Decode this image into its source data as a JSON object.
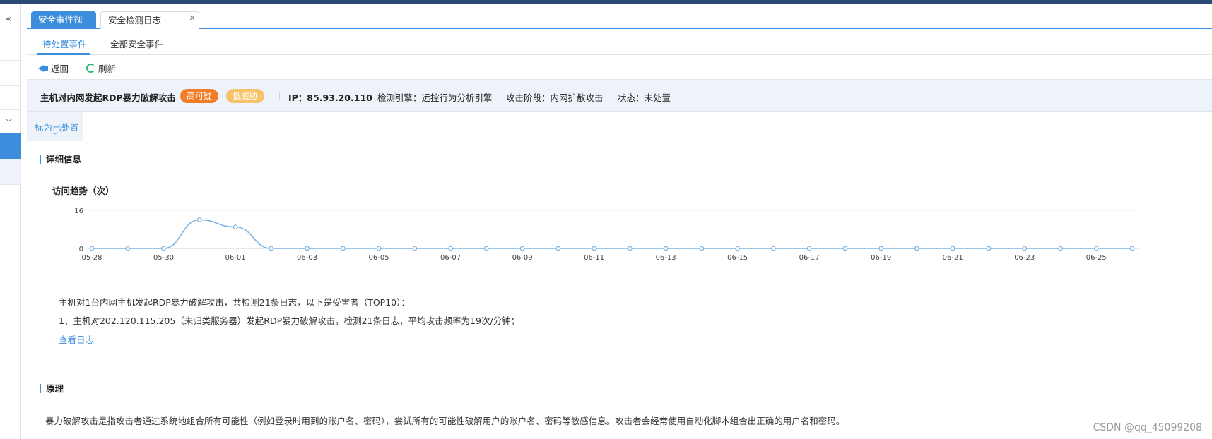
{
  "sidebar": {
    "collapse_glyph": "«"
  },
  "tabs": [
    {
      "label": "安全事件视角",
      "active": true
    },
    {
      "label": "安全检测日志",
      "active": false,
      "close_glyph": "×"
    }
  ],
  "subtabs": [
    {
      "label": "待处置事件",
      "active": true
    },
    {
      "label": "全部安全事件",
      "active": false
    }
  ],
  "toolbar": {
    "back_label": "返回",
    "refresh_label": "刷新"
  },
  "event": {
    "title": "主机对内网发起RDP暴力破解攻击",
    "badge_high": "高可疑",
    "badge_low": "低威胁",
    "ip": "IP：85.93.20.110",
    "engine": "检测引擎：远控行为分析引擎",
    "stage": "攻击阶段：内网扩散攻击",
    "status": "状态：未处置"
  },
  "mark_button_label": "标为已处置",
  "details": {
    "section_title": "详细信息",
    "chart_title": "访问趋势（次）",
    "summary": "主机对1台内网主机发起RDP暴力破解攻击，共检测21条日志，以下是受害者（TOP10）：",
    "item1": "1、主机对202.120.115.205（未归类服务器）发起RDP暴力破解攻击，检测21条日志，平均攻击频率为19次/分钟；",
    "view_log_link": "查看日志"
  },
  "principle": {
    "section_title": "原理",
    "text": "暴力破解攻击是指攻击者通过系统地组合所有可能性（例如登录时用到的账户名、密码），尝试所有的可能性破解用户的账户名、密码等敏感信息。攻击者会经常使用自动化脚本组合出正确的用户名和密码。"
  },
  "watermark": "CSDN @qq_45099208",
  "colors": {
    "accent": "#3c8ddc",
    "line": "#7ab3e3",
    "badge_high": "#f47b27",
    "badge_low": "#f7c469"
  },
  "chart_data": {
    "type": "line",
    "title": "访问趋势（次）",
    "x": [
      "05-28",
      "05-29",
      "05-30",
      "05-31",
      "06-01",
      "06-02",
      "06-03",
      "06-04",
      "06-05",
      "06-06",
      "06-07",
      "06-08",
      "06-09",
      "06-10",
      "06-11",
      "06-12",
      "06-13",
      "06-14",
      "06-15",
      "06-16",
      "06-17",
      "06-18",
      "06-19",
      "06-20",
      "06-21",
      "06-22",
      "06-23",
      "06-24",
      "06-25",
      "06-26"
    ],
    "x_tick_labels": [
      "05-28",
      "05-30",
      "06-01",
      "06-03",
      "06-05",
      "06-07",
      "06-09",
      "06-11",
      "06-13",
      "06-15",
      "06-17",
      "06-19",
      "06-21",
      "06-23",
      "06-25"
    ],
    "series": [
      {
        "values": [
          0,
          0,
          0,
          12,
          9,
          0,
          0,
          0,
          0,
          0,
          0,
          0,
          0,
          0,
          0,
          0,
          0,
          0,
          0,
          0,
          0,
          0,
          0,
          0,
          0,
          0,
          0,
          0,
          0,
          0
        ]
      }
    ],
    "y_ticks": [
      0,
      16
    ],
    "ylim": [
      0,
      16
    ],
    "grid": true
  }
}
